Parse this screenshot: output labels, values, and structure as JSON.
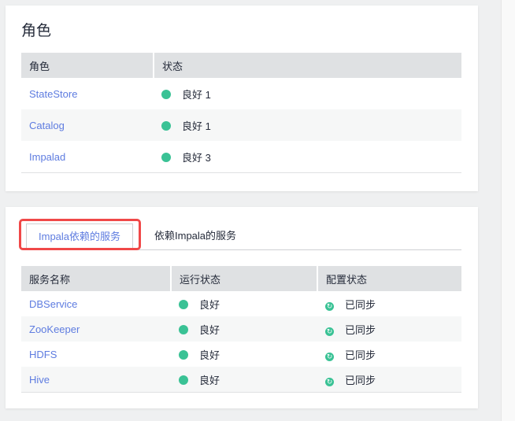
{
  "roles": {
    "title": "角色",
    "headers": [
      "角色",
      "状态"
    ],
    "rows": [
      {
        "name": "StateStore",
        "status": "良好 1"
      },
      {
        "name": "Catalog",
        "status": "良好 1"
      },
      {
        "name": "Impalad",
        "status": "良好 3"
      }
    ]
  },
  "services": {
    "tabs": [
      "Impala依赖的服务",
      "依赖Impala的服务"
    ],
    "headers": [
      "服务名称",
      "运行状态",
      "配置状态"
    ],
    "rows": [
      {
        "name": "DBService",
        "run": "良好",
        "config": "已同步"
      },
      {
        "name": "ZooKeeper",
        "run": "良好",
        "config": "已同步"
      },
      {
        "name": "HDFS",
        "run": "良好",
        "config": "已同步"
      },
      {
        "name": "Hive",
        "run": "良好",
        "config": "已同步"
      }
    ]
  },
  "colors": {
    "good": "#3ac295",
    "link": "#5e7ce0",
    "highlight": "#f04848"
  }
}
